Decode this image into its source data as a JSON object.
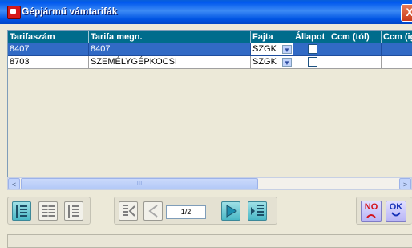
{
  "window": {
    "title": "Gépjármű vámtarifák",
    "close_label": "X"
  },
  "grid": {
    "columns": [
      "Tarifaszám",
      "Tarifa megn.",
      "Fajta",
      "Állapot",
      "Ccm (tól)",
      "Ccm (ig)"
    ],
    "rows": [
      {
        "tarifaszam": "8407",
        "megnevezes": "8407",
        "fajta": "SZGK",
        "allapot": false,
        "selected": true
      },
      {
        "tarifaszam": "8703",
        "megnevezes": "SZEMÉLYGÉPKOCSI",
        "fajta": "SZGK",
        "allapot": false,
        "selected": false
      }
    ]
  },
  "scrollbar": {
    "left_arrow": "<",
    "right_arrow": ">",
    "thumb_grip": "III"
  },
  "toolbar": {
    "page_indicator": "1/2",
    "no_label": "NO",
    "ok_label": "OK"
  },
  "colors": {
    "header_bg": "#006C8C",
    "selected_row": "#316AC5",
    "titlebar": "#0058EE"
  }
}
